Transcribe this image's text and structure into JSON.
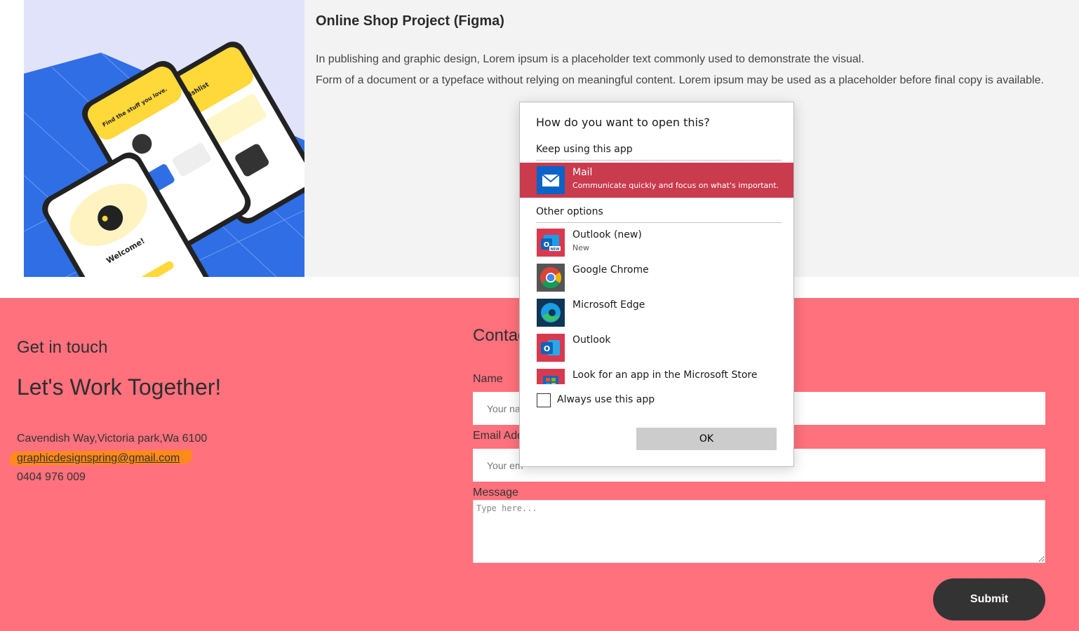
{
  "project": {
    "title": "Online Shop Project (Figma)",
    "desc_line1": "In publishing and graphic design, Lorem ipsum is a placeholder text commonly used to demonstrate the visual.",
    "desc_line2": "Form of a document or a typeface without relying on meaningful content. Lorem ipsum may be used as a placeholder before final copy is available.",
    "image_alt": "phone mockups",
    "mockup_texts": {
      "find": "Find the stuff you love.",
      "wishlist": "Wishlist",
      "welcome": "Welcome!"
    }
  },
  "get_in_touch": {
    "heading": "Get in touch",
    "title": "Let's Work Together!",
    "address": "Cavendish Way,Victoria park,Wa 6100",
    "email": "graphicdesignspring@gmail.com",
    "phone": "0404 976 009"
  },
  "contact_form": {
    "heading": "Contac",
    "name_label": "Name",
    "name_placeholder": "Your na",
    "email_label": "Email Add",
    "email_placeholder": "Your em",
    "message_label": "Message",
    "message_placeholder": "Type here...",
    "submit_label": "Submit"
  },
  "dialog": {
    "title": "How do you want to open this?",
    "keep_using_label": "Keep using this app",
    "selected_app": {
      "name": "Mail",
      "subtitle": "Communicate quickly and focus on what's important.",
      "icon": "mail-icon"
    },
    "other_options_label": "Other options",
    "other_apps": [
      {
        "name": "Outlook (new)",
        "subtitle": "New",
        "icon": "outlook-new-icon"
      },
      {
        "name": "Google Chrome",
        "subtitle": "",
        "icon": "chrome-icon"
      },
      {
        "name": "Microsoft Edge",
        "subtitle": "",
        "icon": "edge-icon"
      },
      {
        "name": "Outlook",
        "subtitle": "",
        "icon": "outlook-icon"
      },
      {
        "name": "Look for an app in the Microsoft Store",
        "subtitle": "",
        "icon": "store-icon"
      }
    ],
    "always_use_label": "Always use this app",
    "always_use_checked": false,
    "ok_label": "OK",
    "accent_color": "#c93b4d"
  },
  "colors": {
    "footer_bg": "#ff717c",
    "highlight": "#ff8a1c",
    "submit_bg": "#333333"
  }
}
